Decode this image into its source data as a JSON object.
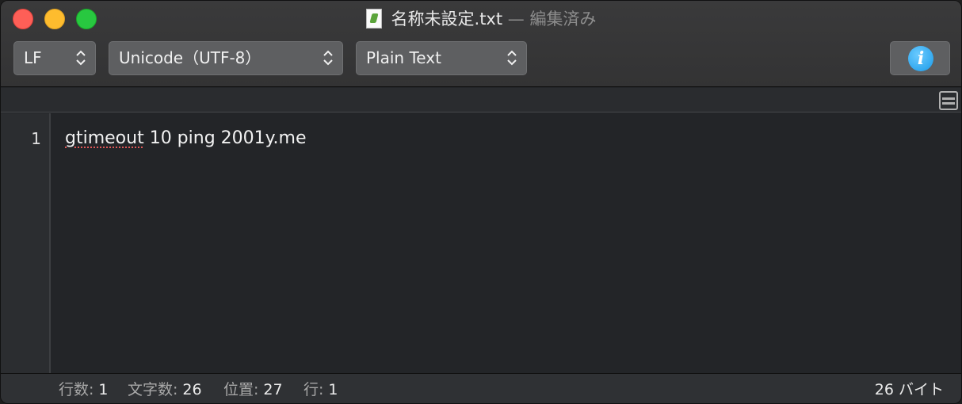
{
  "window": {
    "title": "名称未設定.txt",
    "title_separator": "—",
    "title_status": "編集済み",
    "traffic_colors": {
      "close": "#fe5f57",
      "minimize": "#febc2e",
      "maximize": "#28c840"
    }
  },
  "toolbar": {
    "line_ending": "LF",
    "encoding": "Unicode（UTF-8）",
    "syntax": "Plain Text"
  },
  "editor": {
    "lines": [
      {
        "number": "1",
        "misspelled_word": "gtimeout",
        "rest": " 10 ping 2001y.me"
      }
    ]
  },
  "status_bar": {
    "lines_label": "行数:",
    "lines_value": "1",
    "chars_label": "文字数:",
    "chars_value": "26",
    "position_label": "位置:",
    "position_value": "27",
    "row_label": "行:",
    "row_value": "1",
    "bytes": "26 バイト"
  }
}
